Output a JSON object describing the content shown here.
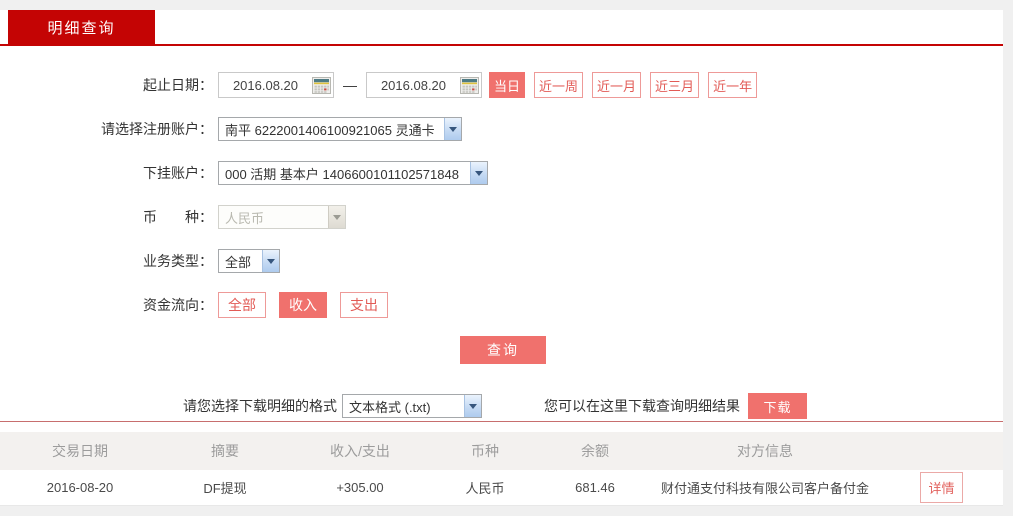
{
  "tab": {
    "label": "明细查询"
  },
  "form": {
    "date_row": {
      "label": "起止日期：",
      "start_date": "2016.08.20",
      "end_date": "2016.08.20",
      "separator": "—",
      "quick_buttons": [
        {
          "label": "当日",
          "active": true
        },
        {
          "label": "近一周",
          "active": false
        },
        {
          "label": "近一月",
          "active": false
        },
        {
          "label": "近三月",
          "active": false
        },
        {
          "label": "近一年",
          "active": false
        }
      ]
    },
    "register_account": {
      "label": "请选择注册账户：",
      "value": "南平 6222001406100921065 灵通卡"
    },
    "sub_account": {
      "label": "下挂账户：",
      "value": "000 活期 基本户 1406600101102571848"
    },
    "currency": {
      "label": "币　　种：",
      "value": "人民币",
      "disabled": true
    },
    "business_type": {
      "label": "业务类型：",
      "value": "全部"
    },
    "fund_direction": {
      "label": "资金流向：",
      "options": [
        {
          "label": "全部",
          "active": false
        },
        {
          "label": "收入",
          "active": true
        },
        {
          "label": "支出",
          "active": false
        }
      ]
    },
    "query_button": "查询"
  },
  "download": {
    "format_label": "请您选择下载明细的格式",
    "format_value": "文本格式 (.txt)",
    "hint": "您可以在这里下载查询明细结果",
    "button": "下载"
  },
  "table": {
    "headers": [
      "交易日期",
      "摘要",
      "收入/支出",
      "币种",
      "余额",
      "对方信息"
    ],
    "rows": [
      {
        "date": "2016-08-20",
        "summary": "DF提现",
        "amount": "+305.00",
        "currency": "人民币",
        "balance": "681.46",
        "counterparty": "财付通支付科技有限公司客户备付金",
        "detail_button": "详情"
      }
    ]
  },
  "colors": {
    "brand_red": "#c40404",
    "accent_pink": "#f0716d",
    "outline_pink": "#ee9a98",
    "amount_red": "#c43a35",
    "header_bg": "#f3f1ef"
  }
}
